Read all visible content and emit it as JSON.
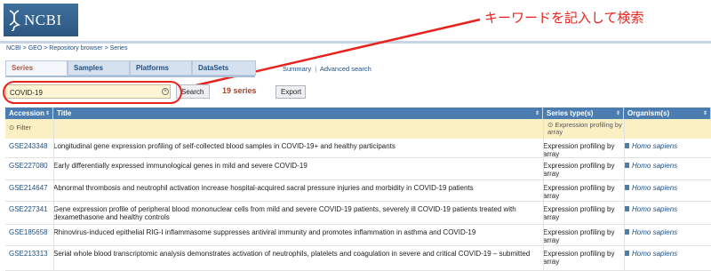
{
  "banner": {
    "logo_text": "NCBI"
  },
  "annotation": {
    "text": "キーワードを記入して検索",
    "color": "#e8231e"
  },
  "breadcrumb": [
    "NCBI",
    "GEO",
    "Repository browser",
    "Series"
  ],
  "tabs": [
    {
      "label": "Series",
      "active": true
    },
    {
      "label": "Samples",
      "active": false
    },
    {
      "label": "Platforms",
      "active": false
    },
    {
      "label": "DataSets",
      "active": false
    }
  ],
  "toplinks": {
    "summary": "Summary",
    "sep": "|",
    "advanced": "Advanced search"
  },
  "search": {
    "value": "COVID-19",
    "button": "Search",
    "count": "19 series",
    "export": "Export",
    "clear_icon": "clear-icon"
  },
  "table": {
    "headers": {
      "accession": "Accession",
      "title": "Title",
      "series_type": "Series type(s)",
      "organism": "Organism(s)"
    },
    "filter": {
      "label": "Filter",
      "series_type": "Expression profiling by array"
    },
    "rows": [
      {
        "accession": "GSE243348",
        "title": "Longitudinal gene expression profiling of self-collected blood samples in COVID-19+ and healthy participants",
        "series_type": "Expression profiling by array",
        "organism": "Homo sapiens"
      },
      {
        "accession": "GSE227080",
        "title": "Early differentially expressed immunological genes in mild and severe COVID-19",
        "series_type": "Expression profiling by array",
        "organism": "Homo sapiens"
      },
      {
        "accession": "GSE214647",
        "title": "Abnormal thrombosis and neutrophil activation increase hospital-acquired sacral pressure injuries and morbidity in COVID-19 patients",
        "series_type": "Expression profiling by array",
        "organism": "Homo sapiens"
      },
      {
        "accession": "GSE227341",
        "title": "Gene expression profile of peripheral blood mononuclear cells from mild and severe COVID-19 patients, severely ill COVID-19 patients treated with dexamethasone and healthy controls",
        "series_type": "Expression profiling by array",
        "organism": "Homo sapiens"
      },
      {
        "accession": "GSE185658",
        "title": "Rhinovirus-induced epithelial RIG-I inflammasome suppresses antiviral immunity and promotes inflammation in asthma and COVID-19",
        "series_type": "Expression profiling by array",
        "organism": "Homo sapiens"
      },
      {
        "accession": "GSE213313",
        "title": "Serial whole blood transcriptomic analysis demonstrates activation of neutrophils, platelets and coagulation in severe and critical COVID-19 – submitted",
        "series_type": "Expression profiling by array",
        "organism": "Homo sapiens"
      }
    ]
  }
}
